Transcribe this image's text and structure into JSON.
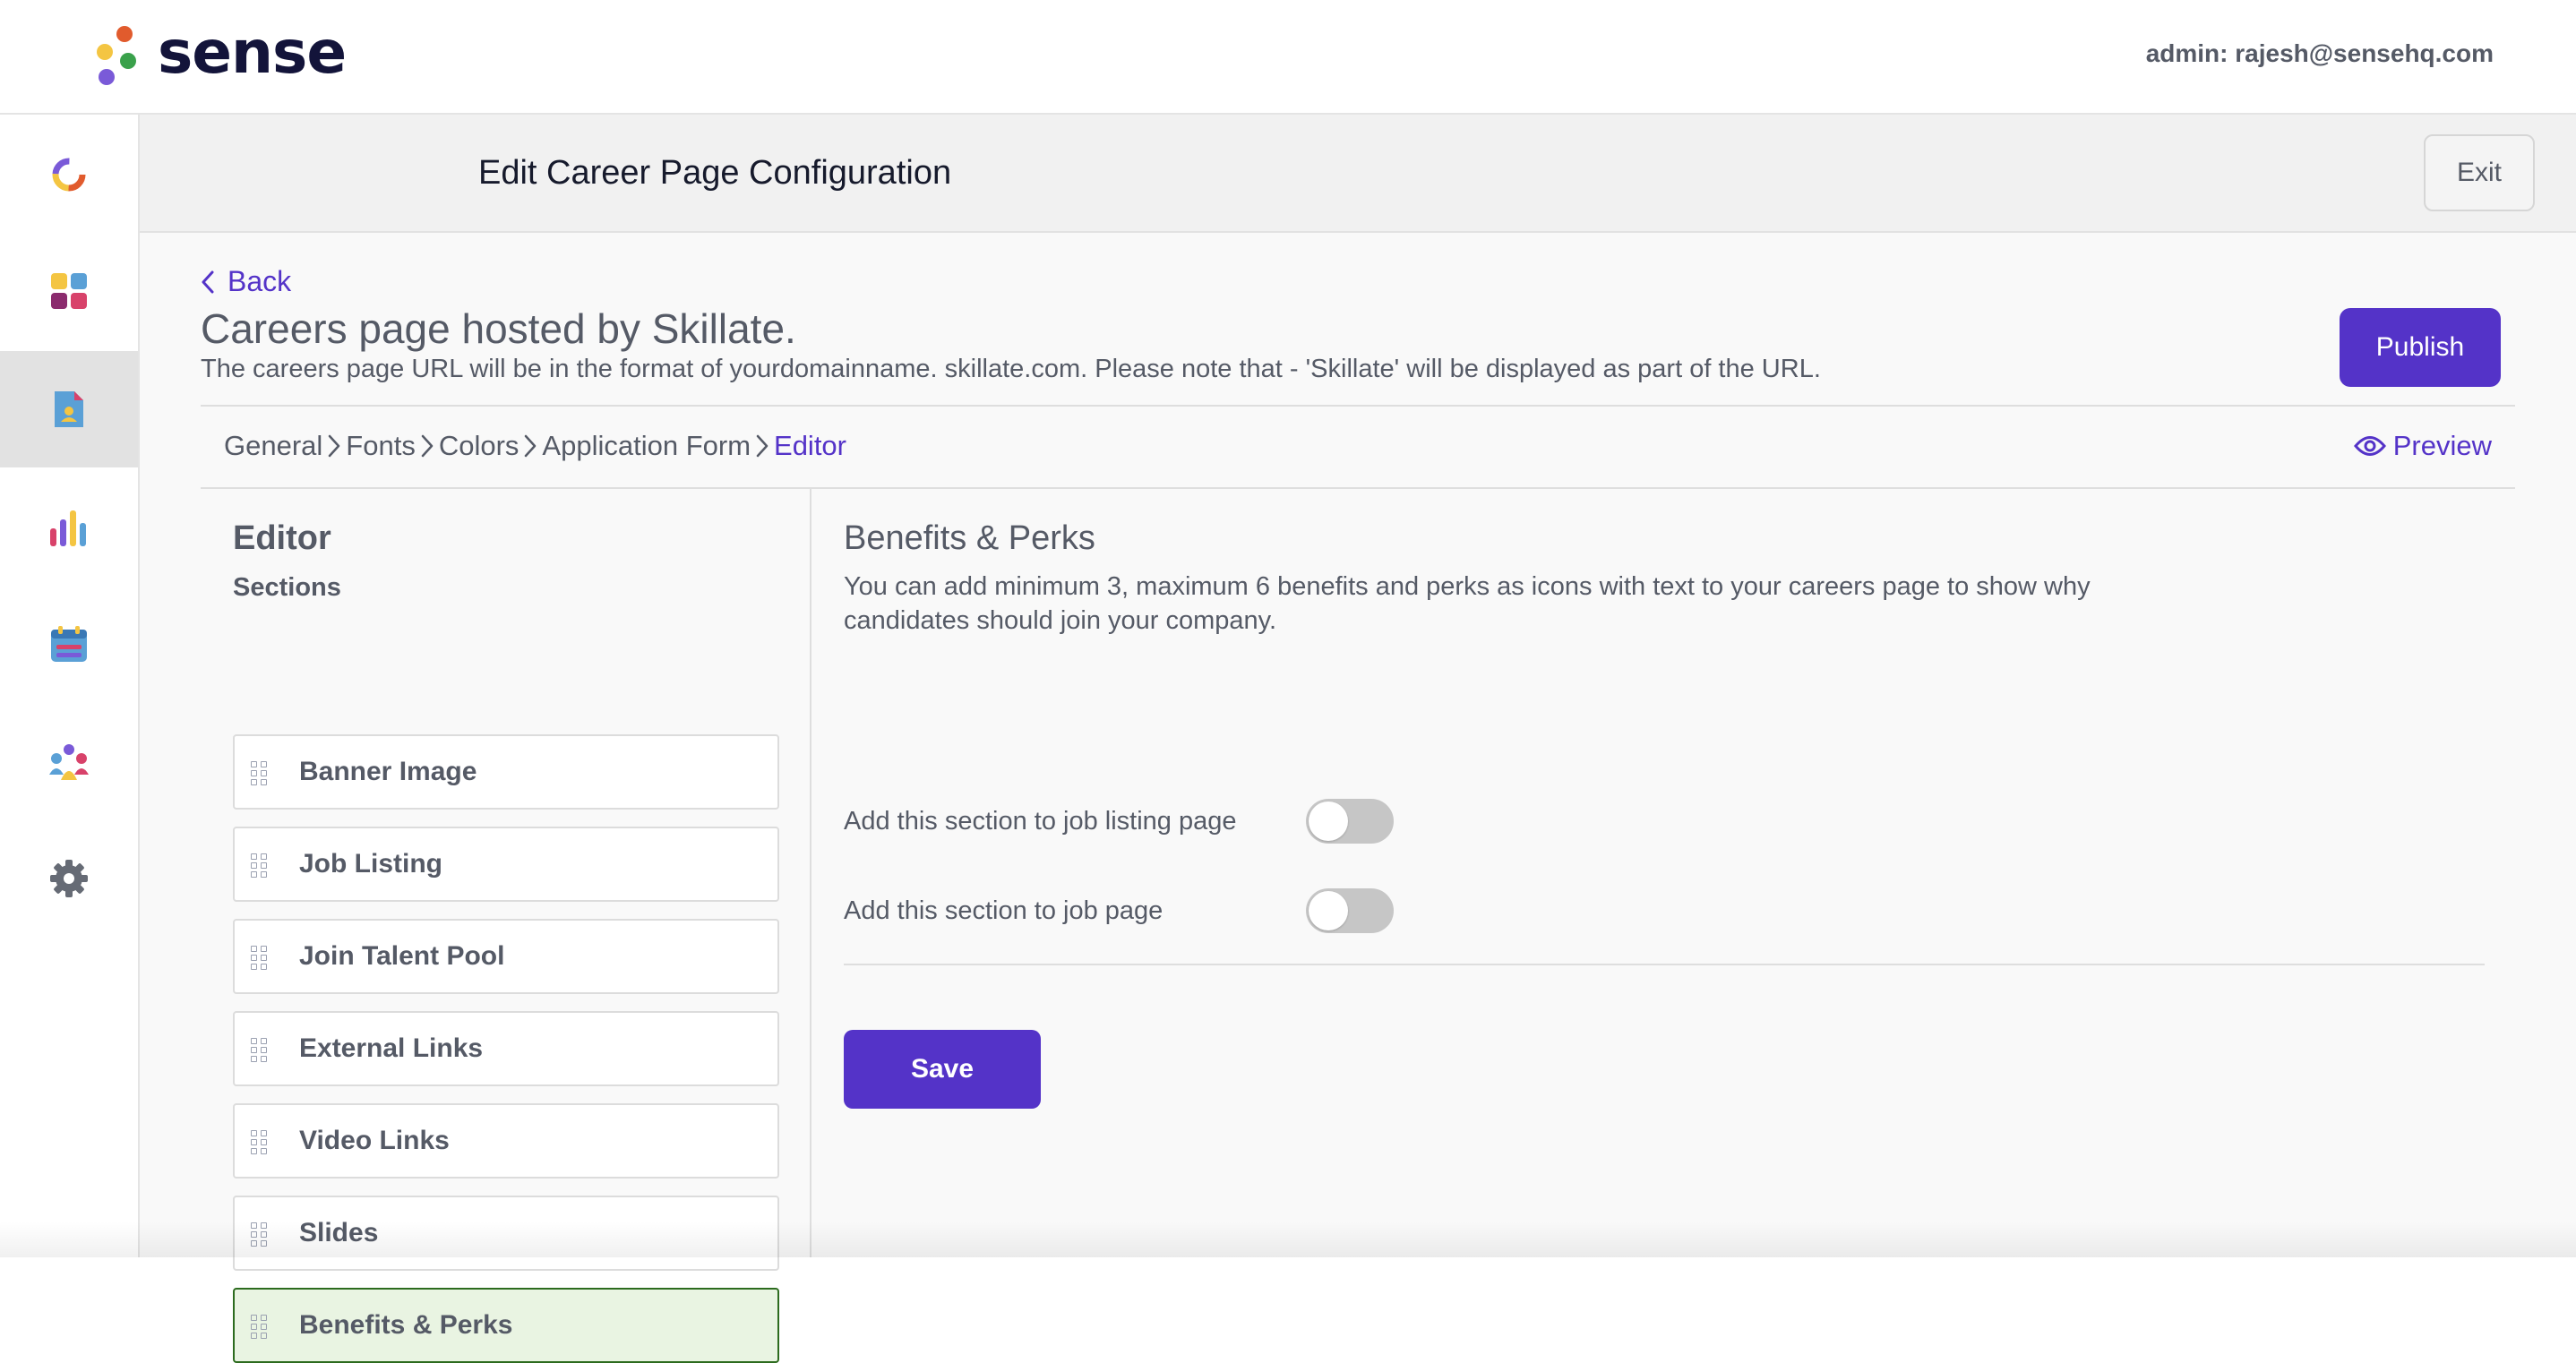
{
  "brand": {
    "name": "sense",
    "dot_colors": [
      "#e15b2d",
      "#f4c542",
      "#3aa14b",
      "#7a5ad8"
    ]
  },
  "header": {
    "admin_label": "admin: rajesh@sensehq.com"
  },
  "sidenav": {
    "items": [
      {
        "name": "dashboard",
        "icon": "donut-icon",
        "active": false
      },
      {
        "name": "apps",
        "icon": "grid-tiles-icon",
        "active": false
      },
      {
        "name": "career-page",
        "icon": "document-user-icon",
        "active": true
      },
      {
        "name": "analytics",
        "icon": "bar-chart-icon",
        "active": false
      },
      {
        "name": "calendar",
        "icon": "calendar-icon",
        "active": false
      },
      {
        "name": "teams",
        "icon": "people-group-icon",
        "active": false
      },
      {
        "name": "settings",
        "icon": "gear-icon",
        "active": false
      }
    ]
  },
  "page": {
    "title": "Edit Career Page Configuration",
    "exit_label": "Exit",
    "back_label": "Back",
    "careers_title": "Careers page hosted by Skillate.",
    "careers_desc": "The careers page URL will be in the format of yourdomainname. skillate.com. Please note that - 'Skillate' will be displayed as part of the URL.",
    "publish_label": "Publish",
    "preview_label": "Preview"
  },
  "breadcrumb": {
    "items": [
      "General",
      "Fonts",
      "Colors",
      "Application Form",
      "Editor"
    ],
    "current_index": 4
  },
  "editor": {
    "title": "Editor",
    "sections_label": "Sections",
    "sections": [
      {
        "label": "Banner Image",
        "selected": false
      },
      {
        "label": "Job Listing",
        "selected": false
      },
      {
        "label": "Join Talent Pool",
        "selected": false
      },
      {
        "label": "External Links",
        "selected": false
      },
      {
        "label": "Video Links",
        "selected": false
      },
      {
        "label": "Slides",
        "selected": false
      },
      {
        "label": "Benefits & Perks",
        "selected": true
      }
    ]
  },
  "settings": {
    "title": "Benefits & Perks",
    "description": "You can add minimum 3, maximum 6 benefits and perks as icons with text to your careers page to show why candidates should join your company.",
    "toggles": [
      {
        "label": "Add this section to job listing page",
        "on": false
      },
      {
        "label": "Add this section to job page",
        "on": false
      }
    ],
    "save_label": "Save"
  },
  "colors": {
    "accent": "#5433c8",
    "selected_bg": "#e9f4e2",
    "selected_border": "#2c6b1e"
  }
}
